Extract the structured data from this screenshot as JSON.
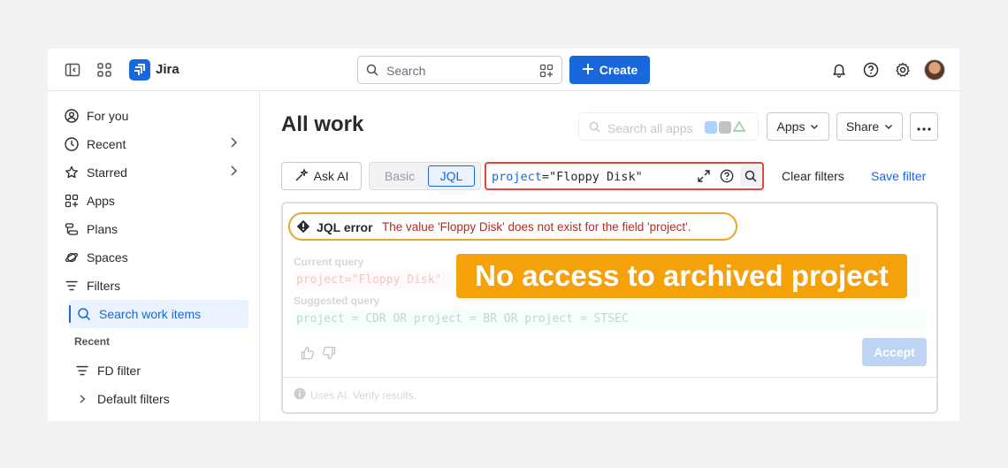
{
  "topbar": {
    "app_name": "Jira",
    "search_placeholder": "Search",
    "create_label": "Create"
  },
  "sidebar": {
    "items": [
      {
        "label": "For you",
        "icon": "user-circle-icon"
      },
      {
        "label": "Recent",
        "icon": "clock-icon"
      },
      {
        "label": "Starred",
        "icon": "star-icon"
      },
      {
        "label": "Apps",
        "icon": "apps-icon"
      },
      {
        "label": "Plans",
        "icon": "plans-icon"
      },
      {
        "label": "Spaces",
        "icon": "planet-icon"
      },
      {
        "label": "Filters",
        "icon": "filter-icon"
      },
      {
        "label": "Search work items",
        "icon": "search-icon"
      }
    ],
    "recent_heading": "Recent",
    "recent_items": [
      {
        "label": "FD filter",
        "icon": "filter-icon"
      },
      {
        "label": "Default filters",
        "icon": "chevron-right-icon"
      }
    ]
  },
  "main": {
    "title": "All work",
    "apps_search_placeholder": "Search all apps",
    "apps_label": "Apps",
    "share_label": "Share",
    "ask_ai_label": "Ask AI",
    "basic_label": "Basic",
    "jql_label": "JQL",
    "jql_query_keyword": "project",
    "jql_query_rest": "=\"Floppy Disk\"",
    "clear_filters_label": "Clear filters",
    "save_filter_label": "Save filter"
  },
  "error_panel": {
    "error_title": "JQL error",
    "error_message": "The value 'Floppy Disk' does not exist for the field 'project'.",
    "current_query_label": "Current query",
    "current_query": "project=\"Floppy Disk\"",
    "suggested_query_label": "Suggested query",
    "suggested_query": "project = CDR OR project = BR OR project = STSEC",
    "accept_label": "Accept",
    "ai_note": "Uses AI. Verify results.",
    "overlay_text": "No access to archived project"
  },
  "colors": {
    "brand_blue": "#1868db",
    "error_red": "#e2483d",
    "highlight_orange": "#f5a10a"
  }
}
